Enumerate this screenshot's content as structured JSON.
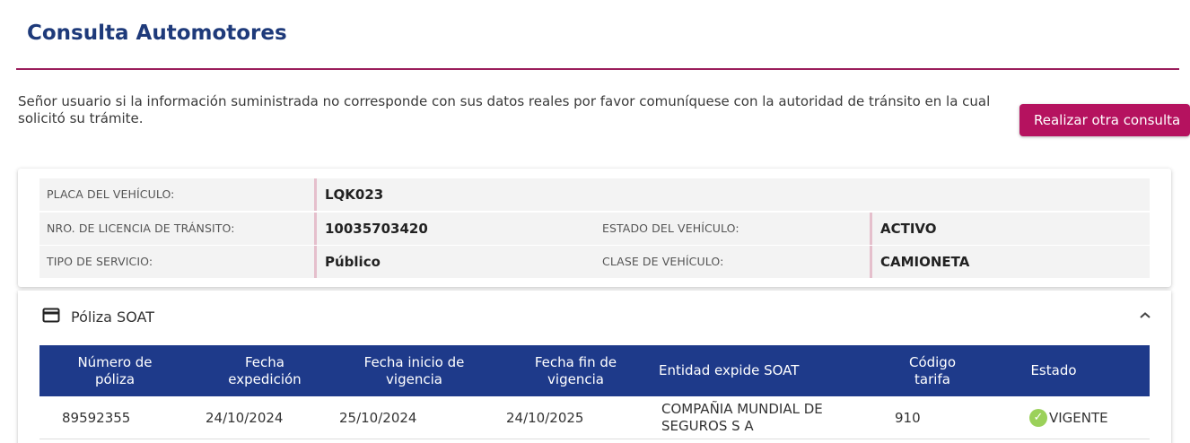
{
  "page": {
    "title": "Consulta Automotores",
    "notice": "Señor usuario si la información suministrada no corresponde con sus datos reales por favor comuníquese con la autoridad de tránsito en la cual solicitó su trámite.",
    "new_query_button": "Realizar otra consulta"
  },
  "vehicle": {
    "plate_label": "PLACA DEL VEHÍCULO:",
    "plate_value": "LQK023",
    "license_label": "NRO. DE LICENCIA DE TRÁNSITO:",
    "license_value": "10035703420",
    "status_label": "ESTADO DEL VEHÍCULO:",
    "status_value": "ACTIVO",
    "service_label": "TIPO DE SERVICIO:",
    "service_value": "Público",
    "class_label": "CLASE DE VEHÍCULO:",
    "class_value": "CAMIONETA"
  },
  "soat": {
    "section_title": "Póliza SOAT",
    "icon": "credit-card-icon",
    "headers": [
      "Número de póliza",
      "Fecha expedición",
      "Fecha inicio de vigencia",
      "Fecha fin de vigencia",
      "Entidad expide SOAT",
      "Código tarifa",
      "Estado"
    ],
    "rows": [
      {
        "policy": "89592355",
        "issued": "24/10/2024",
        "start": "25/10/2024",
        "end": "24/10/2025",
        "entity": "COMPAÑIA MUNDIAL DE SEGUROS S A",
        "tariff": "910",
        "status": "VIGENTE"
      }
    ]
  },
  "colors": {
    "title": "#1e3a7a",
    "accent": "#b5125f",
    "table_header": "#1e3a8a",
    "status_ok": "#9bd15a"
  }
}
